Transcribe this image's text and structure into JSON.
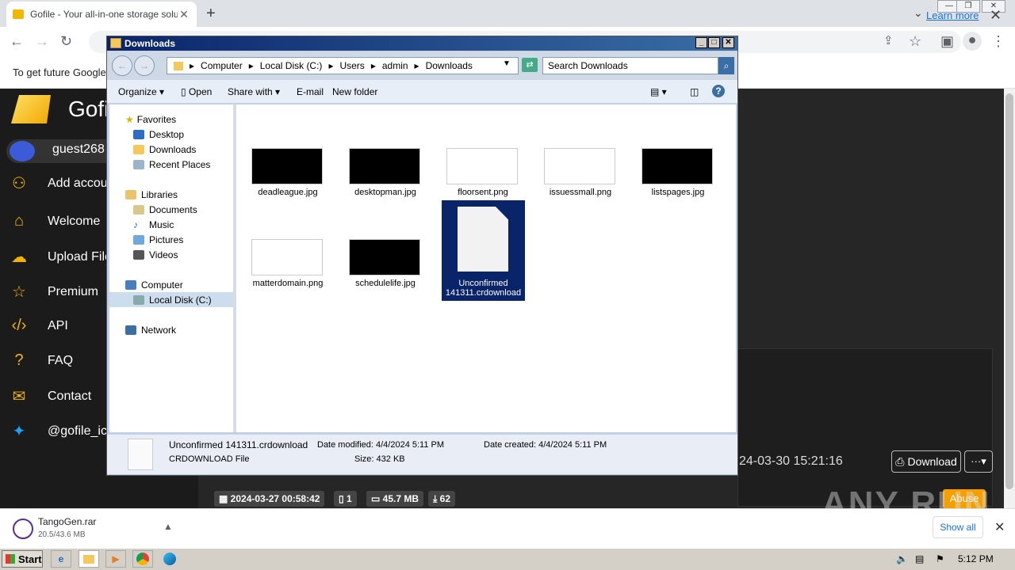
{
  "browser": {
    "tab_title": "Gofile - Your all-in-one storage soluti",
    "infobar_message": "To get future Google",
    "learn_more": "Learn more"
  },
  "site": {
    "brand": "Gofil",
    "username": "guest268",
    "menu": [
      {
        "label": "Add accou",
        "icon": "add-user-icon"
      },
      {
        "label": "Welcome",
        "icon": "home-icon"
      },
      {
        "label": "Upload File",
        "icon": "upload-icon"
      },
      {
        "label": "Premium",
        "icon": "star-icon"
      },
      {
        "label": "API",
        "icon": "code-icon"
      },
      {
        "label": "FAQ",
        "icon": "question-icon"
      },
      {
        "label": "Contact",
        "icon": "mail-icon"
      },
      {
        "label": "@gofile_ic",
        "icon": "twitter-icon"
      }
    ],
    "card_time": "24-03-30 15:21:16",
    "download_label": "Download",
    "more_label": "···▾",
    "stats": {
      "created": "2024-03-27 00:58:42",
      "files": "1",
      "size": "45.7 MB",
      "downloads": "62"
    },
    "abuse": "Abuse",
    "watermark": "ANY RUN"
  },
  "download_shelf": {
    "file_name": "TangoGen.rar",
    "progress": "20.5/43.6 MB",
    "show_all": "Show all"
  },
  "taskbar": {
    "start": "Start",
    "clock": "5:12 PM"
  },
  "explorer": {
    "title": "Downloads",
    "breadcrumb": [
      "Computer",
      "Local Disk (C:)",
      "Users",
      "admin",
      "Downloads"
    ],
    "search_placeholder": "Search Downloads",
    "commands": {
      "organize": "Organize",
      "open": "Open",
      "share_with": "Share with",
      "email": "E-mail",
      "new_folder": "New folder"
    },
    "nav": {
      "favorites": "Favorites",
      "desktop": "Desktop",
      "downloads": "Downloads",
      "recent": "Recent Places",
      "libraries": "Libraries",
      "documents": "Documents",
      "music": "Music",
      "pictures": "Pictures",
      "videos": "Videos",
      "computer": "Computer",
      "local_disk": "Local Disk (C:)",
      "network": "Network"
    },
    "files": [
      {
        "name": "deadleague.jpg",
        "thumb": "#000000"
      },
      {
        "name": "desktopman.jpg",
        "thumb": "#000000"
      },
      {
        "name": "floorsent.png",
        "thumb": "#ffffff"
      },
      {
        "name": "issuessmall.png",
        "thumb": "#ffffff"
      },
      {
        "name": "listspages.jpg",
        "thumb": "#000000"
      },
      {
        "name": "matterdomain.png",
        "thumb": "#ffffff"
      },
      {
        "name": "schedulelife.jpg",
        "thumb": "#000000"
      }
    ],
    "selected_file": {
      "name_line1": "Unconfirmed",
      "name_line2": "141311.crdownload"
    },
    "details": {
      "name": "Unconfirmed 141311.crdownload",
      "type": "CRDOWNLOAD File",
      "modified_label": "Date modified:",
      "modified": "4/4/2024 5:11 PM",
      "created_label": "Date created:",
      "created": "4/4/2024 5:11 PM",
      "size_label": "Size:",
      "size": "432 KB"
    }
  }
}
